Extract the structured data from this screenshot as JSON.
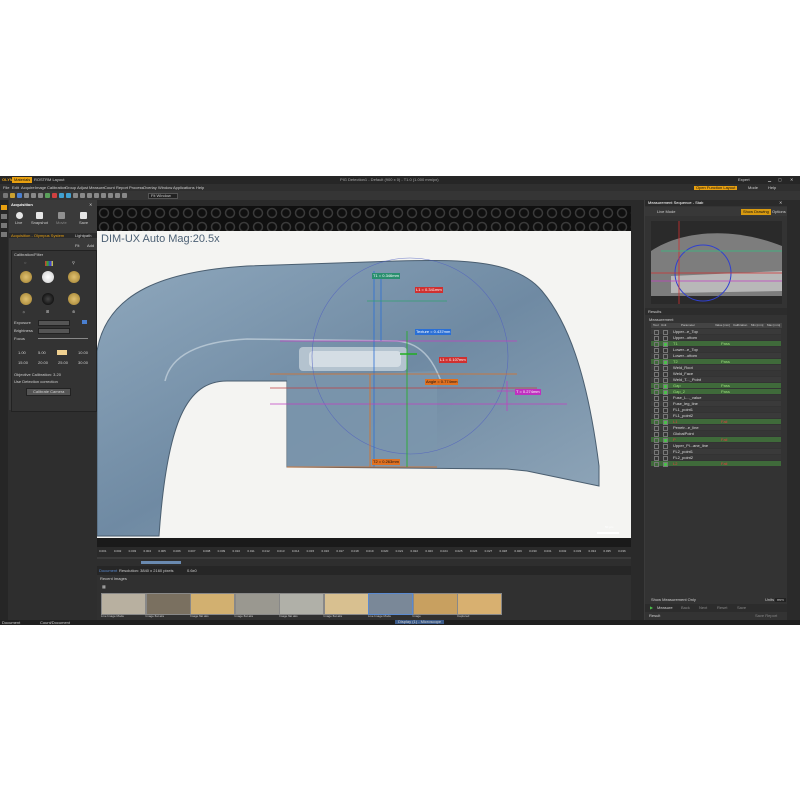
{
  "window": {
    "logo": "OLYMPUS",
    "tabs": [
      "Materials",
      "ROSTRM Layout"
    ],
    "title": "PIG Detection1 - Default (900 x 0) - T1.0 (1.000 mm/px)",
    "right": [
      "Expert",
      "Open Function Layout",
      "Mode",
      "Help"
    ]
  },
  "menu": [
    "File",
    "Edit",
    "Acquire",
    "Image",
    "Calibration",
    "Group",
    "Adjust",
    "Measure",
    "Count",
    "Report",
    "Process",
    "Overlay",
    "Window",
    "Applications",
    "Help"
  ],
  "toolbar": {
    "zoom_select": "Fit Window"
  },
  "left_panel": {
    "title": "Acquisition",
    "actions": [
      "Live",
      "Snapshot",
      "Movie",
      "Save"
    ],
    "camera_tabs": [
      "Acquisition - Olympus System",
      "Lightpath"
    ],
    "quick_labels": [
      "Fit",
      "Add"
    ],
    "section": "Calibration/Filter",
    "gauge_labels": [
      "Exposure",
      "Brightness",
      "Focus"
    ],
    "grid_values": [
      "1.00",
      "5.00",
      "",
      "10.00",
      "15.00",
      "20.00",
      "25.00",
      "30.00"
    ],
    "checkbox_1": "Objective Calibration: 3.20",
    "checkbox_2": "Use Detection correction",
    "button": "Calibrate Camera"
  },
  "viewer": {
    "overlay_text": "DIM-UX Auto  Mag:20.5x",
    "scale_bar": "50 µm",
    "ruler_ticks": [
      "0.001",
      "0.002",
      "0.003",
      "0.004",
      "0.005",
      "0.006",
      "0.007",
      "0.008",
      "0.009",
      "0.010",
      "0.011",
      "0.012",
      "0.013",
      "0.014",
      "0.015",
      "0.016",
      "0.017",
      "0.018",
      "0.019",
      "0.020",
      "0.021",
      "0.022",
      "0.023",
      "0.024",
      "0.025",
      "0.026",
      "0.027",
      "0.028",
      "0.029",
      "0.030",
      "0.031",
      "0.032",
      "0.033",
      "0.034",
      "0.035",
      "0.036"
    ],
    "status": [
      "Document",
      "Resolution: 3840 x 2160 pixels",
      "0.6x0"
    ],
    "labels": [
      {
        "text": "T1 = 0.346mm",
        "color": "#2a8f6f"
      },
      {
        "text": "L1 = 0.341mm",
        "color": "#d03030"
      },
      {
        "text": "Texture = 0.437mm",
        "color": "#2a6fd6"
      },
      {
        "text": "L1 = 0.107mm",
        "color": "#d03030"
      },
      {
        "text": "Angle = 0.774mm",
        "color": "#e07020"
      },
      {
        "text": "T = 0.274mm",
        "color": "#c030c0"
      },
      {
        "text": "T2 = 0.263mm",
        "color": "#e07020"
      }
    ]
  },
  "thumbnails": {
    "header": "Recent Images",
    "items": [
      {
        "caption": "Live Image Mode",
        "bg": "#b8b0a0"
      },
      {
        "caption": "Image flat aks",
        "bg": "#7a7060"
      },
      {
        "caption": "Image flat aks",
        "bg": "#d2b070"
      },
      {
        "caption": "Image flat aks",
        "bg": "#9a9890"
      },
      {
        "caption": "Image flat aks",
        "bg": "#b0b0a8"
      },
      {
        "caption": "Image flat aks",
        "bg": "#d8c090"
      },
      {
        "caption": "Live Image Mode",
        "bg": "#7a8898"
      },
      {
        "caption": "Image",
        "bg": "#c8a060"
      },
      {
        "caption": "Captured",
        "bg": "#d8b070"
      }
    ]
  },
  "right_panel": {
    "title": "Measurement Sequence - Stab",
    "toolbar_label": "Live Mode",
    "toolbar_btn1": "Show Drawing",
    "toolbar_btn2": "Options",
    "section": "Results",
    "subsection": "Measurement",
    "columns": [
      "Tool",
      "Unit",
      "Parameter",
      "Value [mm]",
      "Calibration",
      "Min [mm]",
      "Max [mm]"
    ],
    "rows": [
      {
        "label": "Upper...e_Top",
        "status": "",
        "hl": false
      },
      {
        "label": "Upper...ottom",
        "status": "",
        "hl": false
      },
      {
        "label": "T1",
        "status": "Pass",
        "hl": true
      },
      {
        "label": "Lower...e_Top",
        "status": "",
        "hl": false
      },
      {
        "label": "Lower...ottom",
        "status": "",
        "hl": false
      },
      {
        "label": "T2",
        "status": "Pass",
        "hl": true
      },
      {
        "label": "Weld_Root",
        "status": "",
        "hl": false
      },
      {
        "label": "Weld_Face",
        "status": "",
        "hl": false
      },
      {
        "label": "Weld_T..._Point",
        "status": "",
        "hl": false
      },
      {
        "label": "Gap",
        "status": "Pass",
        "hl": true
      },
      {
        "label": "Gap_2",
        "status": "Pass",
        "hl": true
      },
      {
        "label": "Fuse_L..._value",
        "status": "",
        "hl": false
      },
      {
        "label": "Fuse_leg_line",
        "status": "",
        "hl": false
      },
      {
        "label": "FL1_point1",
        "status": "",
        "hl": false
      },
      {
        "label": "FL1_point2",
        "status": "",
        "hl": false
      },
      {
        "label": "L1",
        "status": "Fail",
        "hl": true
      },
      {
        "label": "Penetr...e_line",
        "status": "",
        "hl": false
      },
      {
        "label": "GlobalPoint",
        "status": "",
        "hl": false
      },
      {
        "label": "P",
        "status": "Fail",
        "hl": true
      },
      {
        "label": "Upper_Pl...ane_line",
        "status": "",
        "hl": false
      },
      {
        "label": "FL2_point1",
        "status": "",
        "hl": false
      },
      {
        "label": "FL2_point2",
        "status": "",
        "hl": false
      },
      {
        "label": "L2",
        "status": "Fail",
        "hl": true
      }
    ],
    "bottom_check": "Show Measurement Only",
    "units_label": "Units",
    "units_value": "mm",
    "run_buttons": [
      "Measure",
      "Back",
      "Next",
      "Reset",
      "Save"
    ],
    "result_label": "Result",
    "save_button": "Save Report"
  },
  "statusbar": [
    "Document",
    "Count/Document",
    "Display (1) - Microscope"
  ]
}
